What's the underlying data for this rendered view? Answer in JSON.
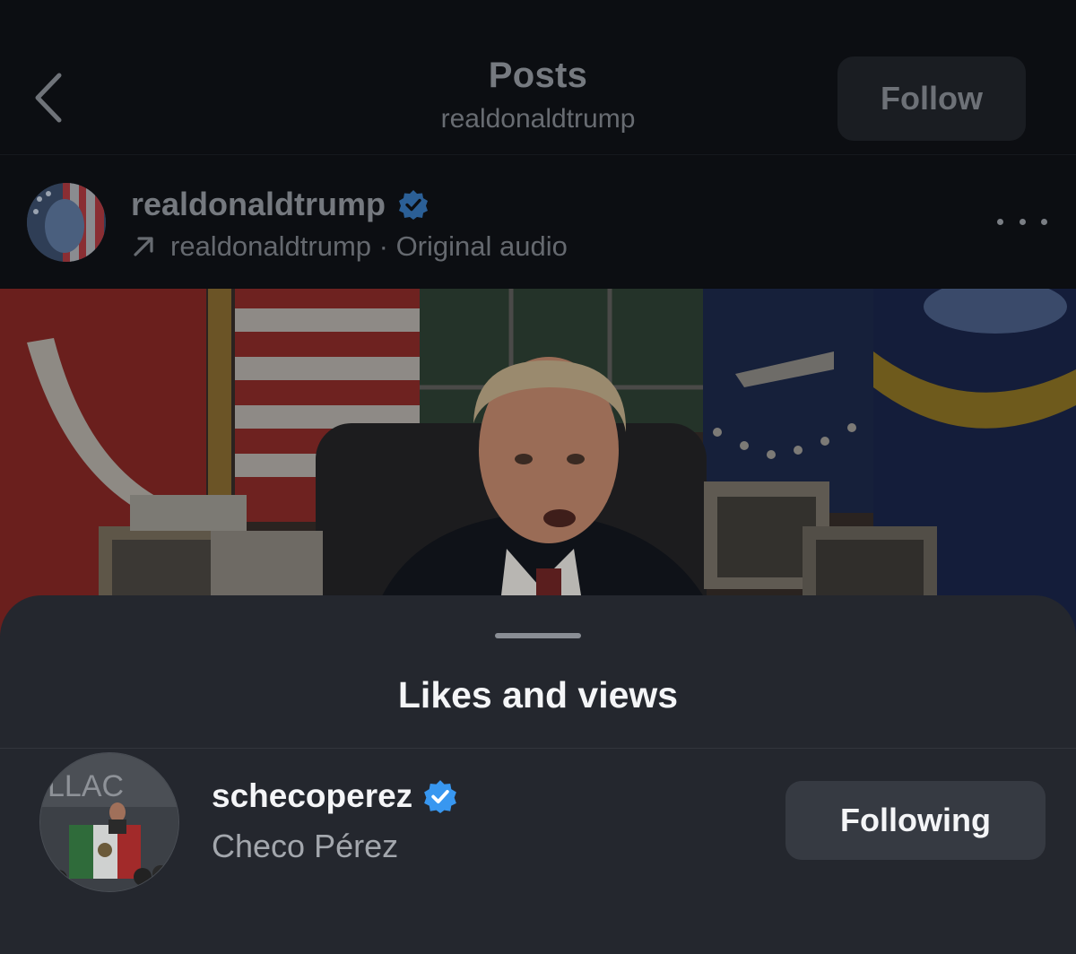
{
  "header": {
    "back_icon": "chevron-left-icon",
    "title": "Posts",
    "subtitle": "realdonaldtrump",
    "follow_label": "Follow"
  },
  "post": {
    "owner_name": "realdonaldtrump",
    "verified_icon": "verified-badge-icon",
    "audio_icon": "arrow-up-right-icon",
    "audio_text": "realdonaldtrump · Original audio",
    "more_icon": "more-horizontal-icon",
    "video_description_hidden": true
  },
  "sheet": {
    "title": "Likes and views",
    "users": [
      {
        "username": "schecoperez",
        "full_name": "Checo Pérez",
        "verified": true,
        "button_label": "Following"
      }
    ]
  },
  "colors": {
    "background": "#0b0d11",
    "sheet": "#24272e",
    "verified_blue": "#3897f0",
    "button_bg": "#363a42"
  }
}
